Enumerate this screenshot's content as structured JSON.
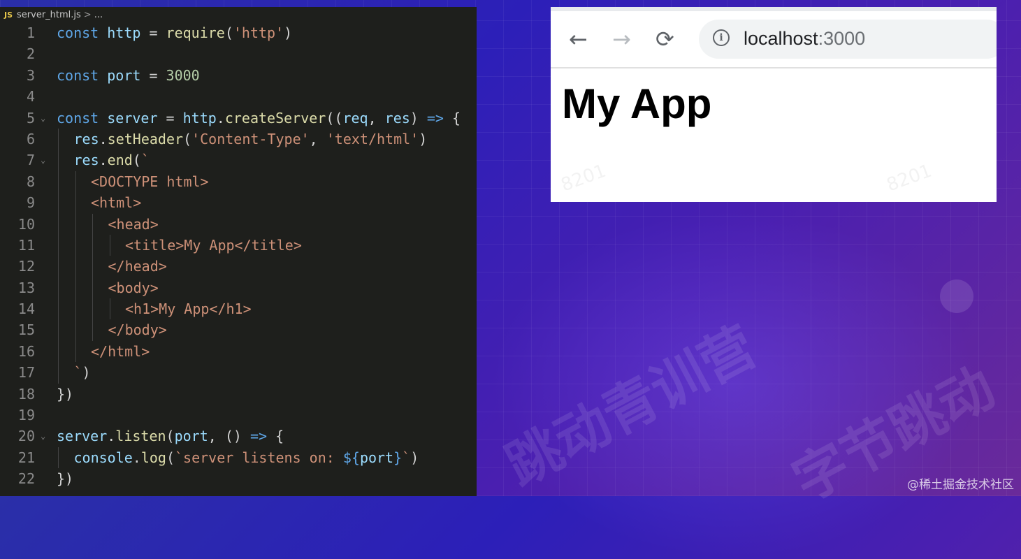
{
  "editor": {
    "breadcrumb": {
      "file_badge": "JS",
      "file_name": "server_html.js",
      "separator": ">",
      "ellipsis": "..."
    },
    "lines": [
      {
        "n": "1",
        "indent": 0,
        "tokens": [
          [
            "k",
            "const "
          ],
          [
            "v",
            "http"
          ],
          [
            "p",
            " = "
          ],
          [
            "f",
            "require"
          ],
          [
            "p",
            "("
          ],
          [
            "s",
            "'http'"
          ],
          [
            "p",
            ")"
          ]
        ]
      },
      {
        "n": "2",
        "indent": 0,
        "tokens": []
      },
      {
        "n": "3",
        "indent": 0,
        "tokens": [
          [
            "k",
            "const "
          ],
          [
            "v",
            "port"
          ],
          [
            "p",
            " = "
          ],
          [
            "n",
            "3000"
          ]
        ]
      },
      {
        "n": "4",
        "indent": 0,
        "tokens": []
      },
      {
        "n": "5",
        "indent": 0,
        "fold": true,
        "tokens": [
          [
            "k",
            "const "
          ],
          [
            "v",
            "server"
          ],
          [
            "p",
            " = "
          ],
          [
            "v",
            "http"
          ],
          [
            "p",
            "."
          ],
          [
            "f",
            "createServer"
          ],
          [
            "p",
            "(("
          ],
          [
            "v",
            "req"
          ],
          [
            "p",
            ", "
          ],
          [
            "v",
            "res"
          ],
          [
            "p",
            ") "
          ],
          [
            "k",
            "=>"
          ],
          [
            "p",
            " {"
          ]
        ]
      },
      {
        "n": "6",
        "indent": 1,
        "tokens": [
          [
            "v",
            "res"
          ],
          [
            "p",
            "."
          ],
          [
            "f",
            "setHeader"
          ],
          [
            "p",
            "("
          ],
          [
            "s",
            "'Content-Type'"
          ],
          [
            "p",
            ", "
          ],
          [
            "s",
            "'text/html'"
          ],
          [
            "p",
            ")"
          ]
        ]
      },
      {
        "n": "7",
        "indent": 1,
        "fold": true,
        "tokens": [
          [
            "v",
            "res"
          ],
          [
            "p",
            "."
          ],
          [
            "f",
            "end"
          ],
          [
            "p",
            "("
          ],
          [
            "s",
            "`"
          ]
        ]
      },
      {
        "n": "8",
        "indent": 2,
        "tokens": [
          [
            "tg",
            "<DOCTYPE html>"
          ]
        ]
      },
      {
        "n": "9",
        "indent": 2,
        "tokens": [
          [
            "tg",
            "<html>"
          ]
        ]
      },
      {
        "n": "10",
        "indent": 3,
        "tokens": [
          [
            "tg",
            "<head>"
          ]
        ]
      },
      {
        "n": "11",
        "indent": 4,
        "tokens": [
          [
            "tg",
            "<title>My App</title>"
          ]
        ]
      },
      {
        "n": "12",
        "indent": 3,
        "tokens": [
          [
            "tg",
            "</head>"
          ]
        ]
      },
      {
        "n": "13",
        "indent": 3,
        "tokens": [
          [
            "tg",
            "<body>"
          ]
        ]
      },
      {
        "n": "14",
        "indent": 4,
        "tokens": [
          [
            "tg",
            "<h1>My App</h1>"
          ]
        ]
      },
      {
        "n": "15",
        "indent": 3,
        "tokens": [
          [
            "tg",
            "</body>"
          ]
        ]
      },
      {
        "n": "16",
        "indent": 2,
        "tokens": [
          [
            "tg",
            "</html>"
          ]
        ]
      },
      {
        "n": "17",
        "indent": 1,
        "tokens": [
          [
            "s",
            "`"
          ],
          [
            "p",
            ")"
          ]
        ]
      },
      {
        "n": "18",
        "indent": 0,
        "tokens": [
          [
            "p",
            "})"
          ]
        ]
      },
      {
        "n": "19",
        "indent": 0,
        "tokens": []
      },
      {
        "n": "20",
        "indent": 0,
        "fold": true,
        "tokens": [
          [
            "v",
            "server"
          ],
          [
            "p",
            "."
          ],
          [
            "f",
            "listen"
          ],
          [
            "p",
            "("
          ],
          [
            "v",
            "port"
          ],
          [
            "p",
            ", () "
          ],
          [
            "k",
            "=>"
          ],
          [
            "p",
            " {"
          ]
        ]
      },
      {
        "n": "21",
        "indent": 1,
        "tokens": [
          [
            "v",
            "console"
          ],
          [
            "p",
            "."
          ],
          [
            "f",
            "log"
          ],
          [
            "p",
            "("
          ],
          [
            "s",
            "`server listens on: "
          ],
          [
            "k",
            "${"
          ],
          [
            "v",
            "port"
          ],
          [
            "k",
            "}"
          ],
          [
            "s",
            "`"
          ],
          [
            "p",
            ")"
          ]
        ]
      },
      {
        "n": "22",
        "indent": 0,
        "tokens": [
          [
            "p",
            "})"
          ]
        ]
      }
    ]
  },
  "browser": {
    "back_icon": "arrow-left-icon",
    "forward_icon": "arrow-right-icon",
    "reload_icon": "reload-icon",
    "info_icon": "info-icon",
    "url_host": "localhost",
    "url_port": ":3000",
    "page_heading": "My App"
  },
  "background": {
    "watermark_cn_1": "跳动青训营",
    "watermark_cn_2": "字节跳动",
    "watermark_code": "8201",
    "credit": "@稀土掘金技术社区"
  }
}
